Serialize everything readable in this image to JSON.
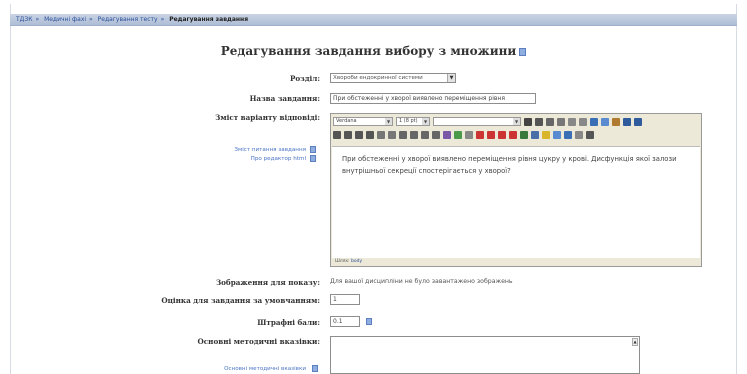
{
  "breadcrumb": {
    "items": [
      "ТДЗК",
      "Медичні фахі",
      "Редагування тесту"
    ],
    "current": "Редагування завдання"
  },
  "page": {
    "title": "Редагування завдання вибору з множини"
  },
  "form": {
    "section": {
      "label": "Розділ:",
      "value": "Хвороби ендокринної системи"
    },
    "name": {
      "label": "Назва завдання:",
      "value": "При обстеженні у хворої виявлено переміщення рівня"
    },
    "content": {
      "label": "Зміст варіанту відповіді:",
      "links": [
        "Зміст питання завдання",
        "Про редактор html"
      ],
      "toolbar": {
        "font": "Verdana",
        "size": "1 (8 pt)",
        "style": ""
      },
      "text": "При обстеженні у хворої виявлено переміщення рівня цукру у крові. Дисфункція якої залози внутрішньої секреції спостерігається у хворої?",
      "path_label": "Шлях:",
      "path_value": "body"
    },
    "image": {
      "label": "Зображення для показу:",
      "value": "Для вашої дисципліни не було завантажено зображень"
    },
    "default_grade": {
      "label": "Оцінка для завдання за умовчанням:",
      "value": "1"
    },
    "penalty": {
      "label": "Штрафні бали:",
      "value": "0.1"
    },
    "guidance": {
      "label": "Основні методичні вказівки:",
      "link": "Основні методичні вказівки"
    }
  },
  "colors": {
    "navbar": "#b4c2da",
    "link": "#4a73c4",
    "editor_bg": "#ece9d8"
  }
}
